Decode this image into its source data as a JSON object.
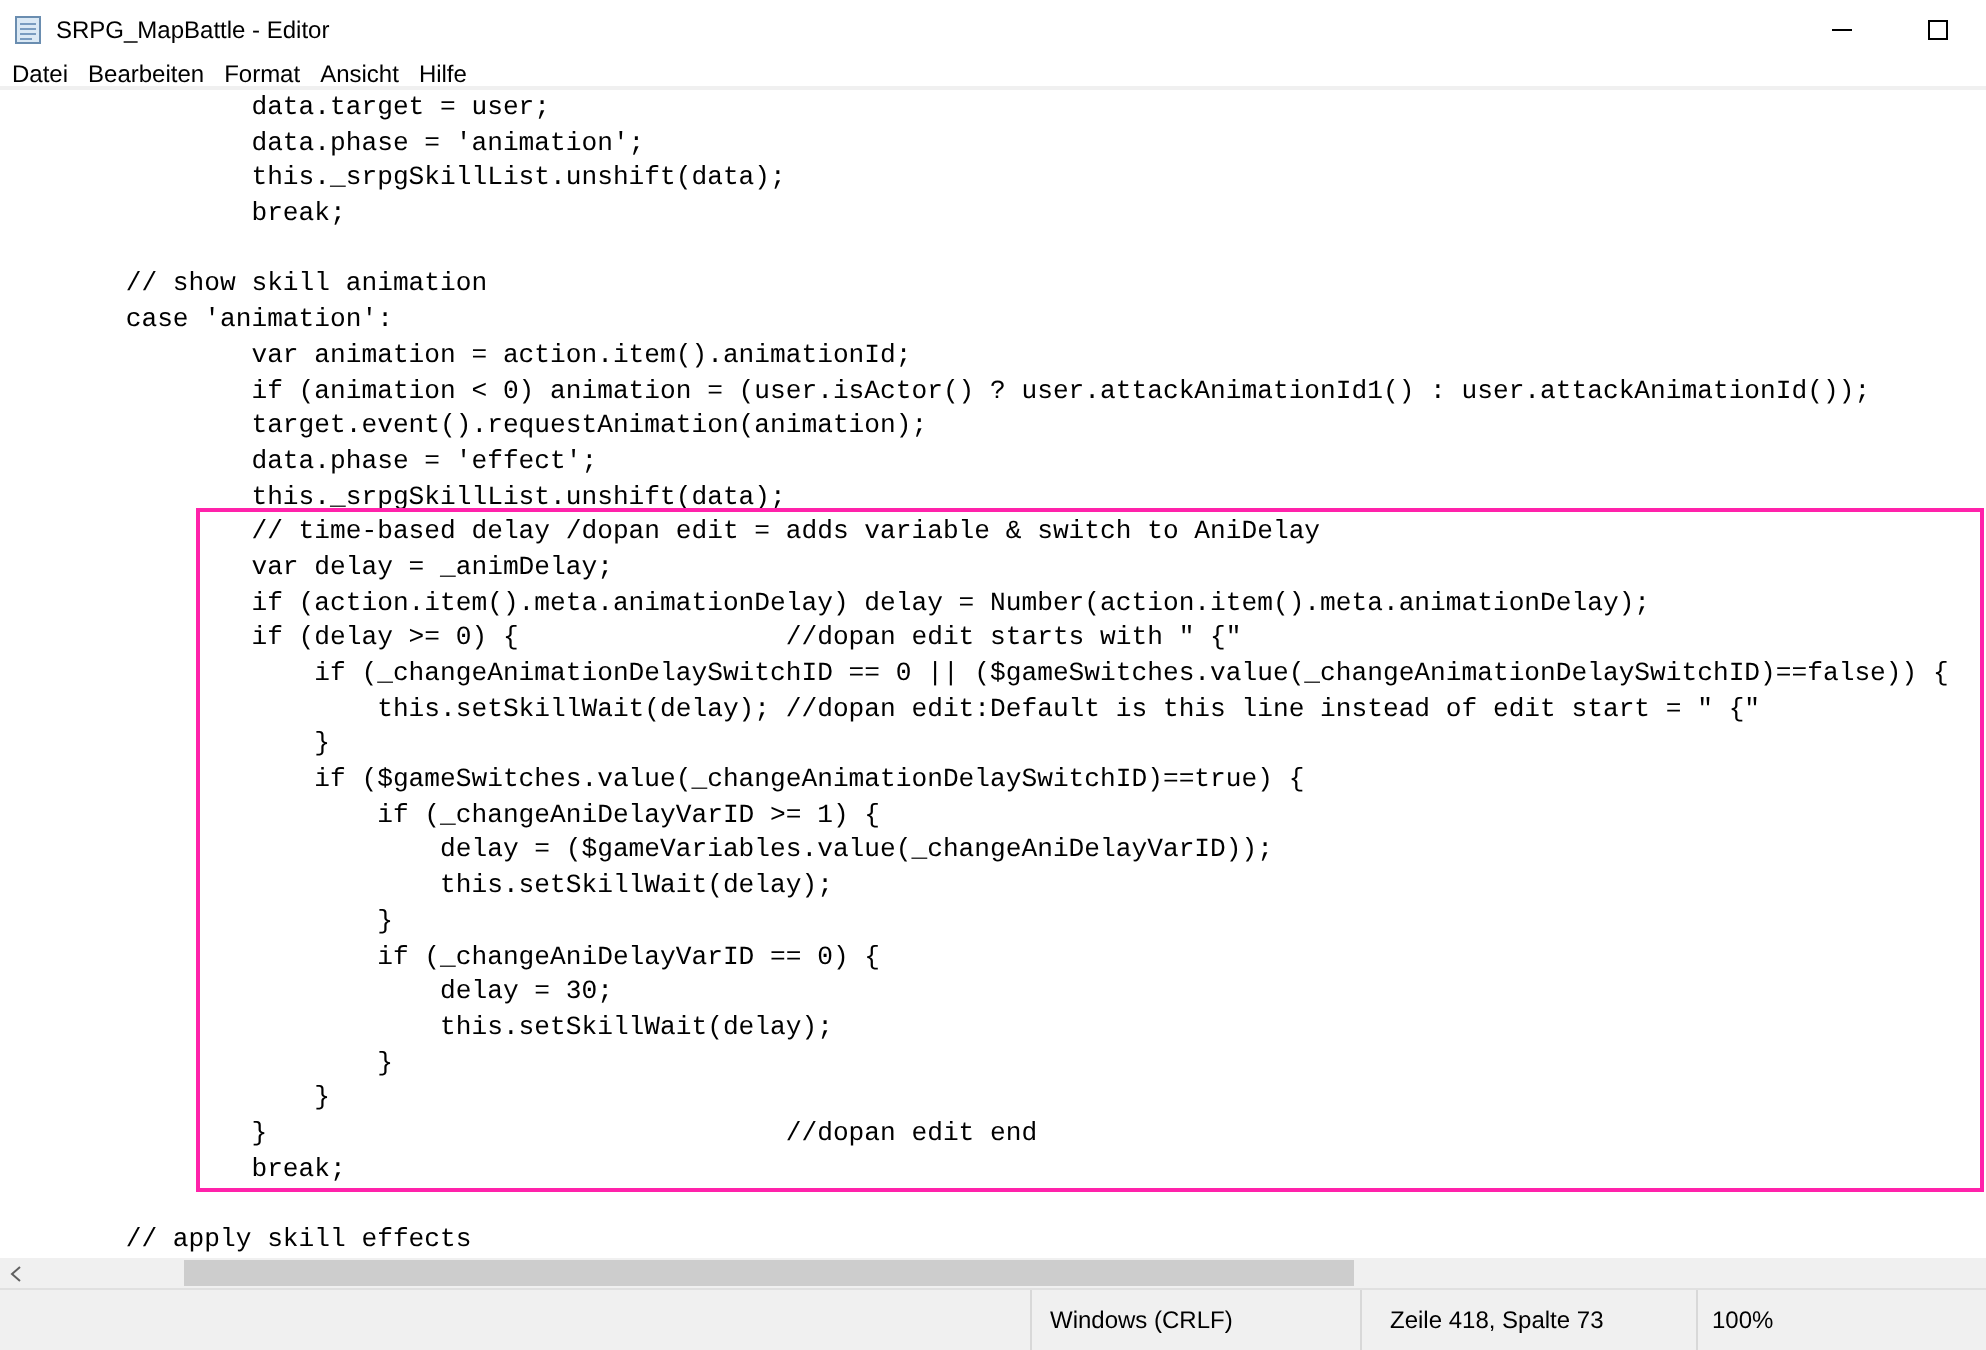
{
  "window": {
    "title": "SRPG_MapBattle - Editor"
  },
  "menu": [
    "Datei",
    "Bearbeiten",
    "Format",
    "Ansicht",
    "Hilfe"
  ],
  "code": [
    {
      "kind": "plain",
      "blank_before": false,
      "lines": [
        "                data.target = user;",
        "                data.phase = 'animation';",
        "                this._srpgSkillList.unshift(data);",
        "                break;"
      ]
    },
    {
      "kind": "plain",
      "blank_before": true,
      "lines": [
        "        // show skill animation",
        "        case 'animation':",
        "                var animation = action.item().animationId;",
        "                if (animation < 0) animation = (user.isActor() ? user.attackAnimationId1() : user.attackAnimationId());",
        "                target.event().requestAnimation(animation);",
        "                data.phase = 'effect';",
        "                this._srpgSkillList.unshift(data);"
      ]
    },
    {
      "kind": "highlighted",
      "blank_before": false,
      "lines": [
        "                // time-based delay /dopan edit = adds variable & switch to AniDelay",
        "                var delay = _animDelay;",
        "                if (action.item().meta.animationDelay) delay = Number(action.item().meta.animationDelay);",
        "                if (delay >= 0) {                 //dopan edit starts with \" {\"",
        "                    if (_changeAnimationDelaySwitchID == 0 || ($gameSwitches.value(_changeAnimationDelaySwitchID)==false)) {",
        "                        this.setSkillWait(delay); //dopan edit:Default is this line instead of edit start = \" {\"",
        "                    }",
        "                    if ($gameSwitches.value(_changeAnimationDelaySwitchID)==true) {",
        "                        if (_changeAniDelayVarID >= 1) {",
        "                            delay = ($gameVariables.value(_changeAniDelayVarID));",
        "                            this.setSkillWait(delay);",
        "                        }",
        "                        if (_changeAniDelayVarID == 0) {",
        "                            delay = 30;",
        "                            this.setSkillWait(delay);",
        "                        }",
        "                    }",
        "                }                                 //dopan edit end",
        "                break;"
      ]
    },
    {
      "kind": "plain",
      "blank_before": true,
      "lines": [
        "        // apply skill effects"
      ]
    }
  ],
  "status_bar": [
    "Windows (CRLF)",
    "Zeile 418, Spalte 73",
    "100%"
  ]
}
